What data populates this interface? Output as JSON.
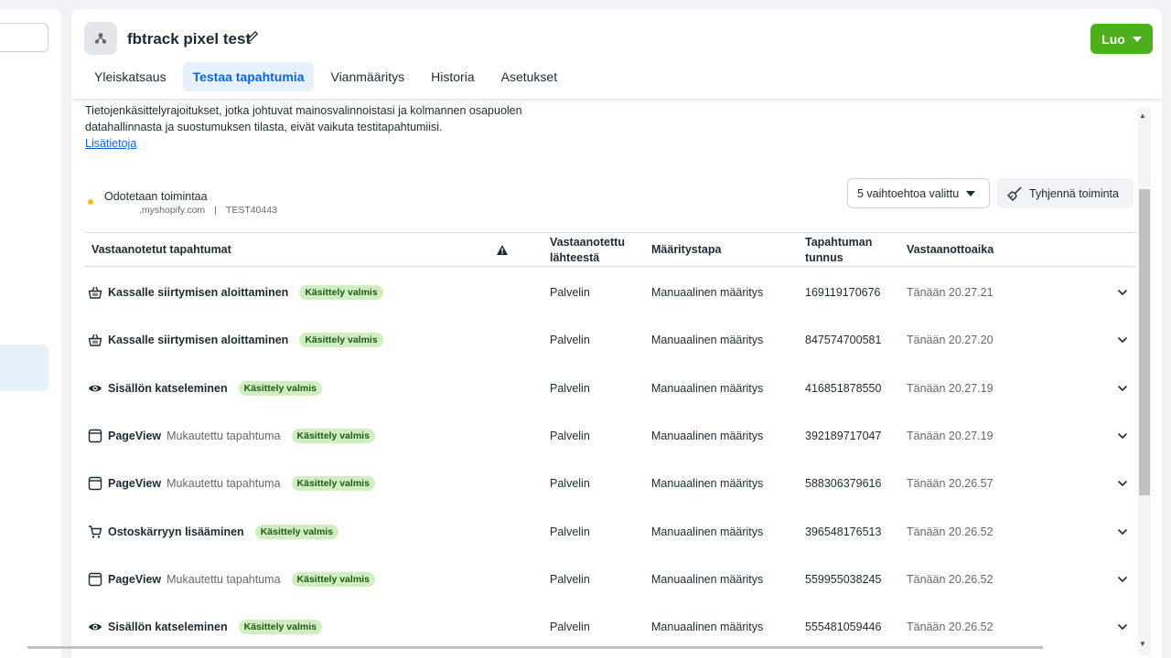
{
  "header": {
    "title": "fbtrack pixel test",
    "create_label": "Luo",
    "tabs": [
      {
        "label": "Yleiskatsaus",
        "active": false
      },
      {
        "label": "Testaa tapahtumia",
        "active": true
      },
      {
        "label": "Vianmääritys",
        "active": false
      },
      {
        "label": "Historia",
        "active": false
      },
      {
        "label": "Asetukset",
        "active": false
      }
    ]
  },
  "notice": {
    "line1": "Tietojenkäsittelyrajoitukset, jotka johtuvat mainosvalinnoistasi ja kolmannen osapuolen",
    "line2": "datahallinnasta ja suostumuksen tilasta, eivät vaikuta testitapahtumiisi.",
    "link": "Lisätietoja"
  },
  "status": {
    "text": "Odotetaan toimintaa",
    "domain": ".myshopify.com",
    "separator": "|",
    "code": "TEST40443"
  },
  "filter_label": "5 vaihtoehtoa valittu",
  "clear_label": "Tyhjennä toiminta",
  "table": {
    "headers": {
      "events": "Vastaanotetut tapahtumat",
      "source_line1": "Vastaanotettu",
      "source_line2": "lähteestä",
      "setup": "Määritystapa",
      "id_line1": "Tapahtuman",
      "id_line2": "tunnus",
      "time": "Vastaanottoaika"
    },
    "rows": [
      {
        "icon": "basket-icon",
        "name": "Kassalle siirtymisen aloittaminen",
        "sub": "",
        "badge": "Käsittely valmis",
        "source": "Palvelin",
        "setup": "Manuaalinen määritys",
        "id": "169119170676",
        "time": "Tänään 20.27.21"
      },
      {
        "icon": "basket-icon",
        "name": "Kassalle siirtymisen aloittaminen",
        "sub": "",
        "badge": "Käsittely valmis",
        "source": "Palvelin",
        "setup": "Manuaalinen määritys",
        "id": "847574700581",
        "time": "Tänään 20.27.20"
      },
      {
        "icon": "eye-icon",
        "name": "Sisällön katseleminen",
        "sub": "",
        "badge": "Käsittely valmis",
        "source": "Palvelin",
        "setup": "Manuaalinen määritys",
        "id": "416851878550",
        "time": "Tänään 20.27.19"
      },
      {
        "icon": "browser-window-icon",
        "name": "PageView",
        "sub": "Mukautettu tapahtuma",
        "badge": "Käsittely valmis",
        "source": "Palvelin",
        "setup": "Manuaalinen määritys",
        "id": "392189717047",
        "time": "Tänään 20.27.19"
      },
      {
        "icon": "browser-window-icon",
        "name": "PageView",
        "sub": "Mukautettu tapahtuma",
        "badge": "Käsittely valmis",
        "source": "Palvelin",
        "setup": "Manuaalinen määritys",
        "id": "588306379616",
        "time": "Tänään 20.26.57"
      },
      {
        "icon": "cart-icon",
        "name": "Ostoskärryyn lisääminen",
        "sub": "",
        "badge": "Käsittely valmis",
        "source": "Palvelin",
        "setup": "Manuaalinen määritys",
        "id": "396548176513",
        "time": "Tänään 20.26.52"
      },
      {
        "icon": "browser-window-icon",
        "name": "PageView",
        "sub": "Mukautettu tapahtuma",
        "badge": "Käsittely valmis",
        "source": "Palvelin",
        "setup": "Manuaalinen määritys",
        "id": "559955038245",
        "time": "Tänään 20.26.52"
      },
      {
        "icon": "eye-icon",
        "name": "Sisällön katseleminen",
        "sub": "",
        "badge": "Käsittely valmis",
        "source": "Palvelin",
        "setup": "Manuaalinen määritys",
        "id": "555481059446",
        "time": "Tänään 20.26.52"
      }
    ]
  },
  "colors": {
    "accent": "#0a66d8",
    "create_button": "#4caf1b",
    "badge_bg": "#d0efc0",
    "status_dot": "#f7b928"
  }
}
